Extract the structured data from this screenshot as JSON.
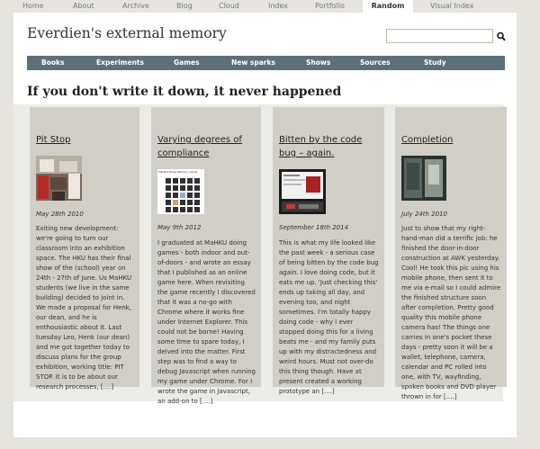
{
  "top_nav": {
    "items": [
      {
        "label": "Home"
      },
      {
        "label": "About"
      },
      {
        "label": "Archive"
      },
      {
        "label": "Blog"
      },
      {
        "label": "Cloud"
      },
      {
        "label": "Index"
      },
      {
        "label": "Portfolio"
      },
      {
        "label": "Random"
      },
      {
        "label": "Visual Index"
      }
    ],
    "active": "Random"
  },
  "header": {
    "site_title": "Everdien's external memory",
    "search": {
      "value": "",
      "placeholder": ""
    },
    "search_icon": "magnifier-icon"
  },
  "category_nav": {
    "items": [
      {
        "label": "Books"
      },
      {
        "label": "Experiments"
      },
      {
        "label": "Games"
      },
      {
        "label": "New sparks"
      },
      {
        "label": "Shows"
      },
      {
        "label": "Sources"
      },
      {
        "label": "Study"
      }
    ]
  },
  "main": {
    "headline": "If you don't write it down, it never happened",
    "cards": [
      {
        "title": "Pit Stop",
        "date": "May 28th 2010",
        "body": "Exiting new development: we're going to turn our classroom into an exhibition space. The HKU has their final show of the (school) year on 24th - 27th of June. Us MaHKU students (we live in the same building) decided to joint in. We made a proposal for Henk, our dean, and he is enthousiastic about it. Last tuesday Leo, Henk (our dean)  and me  got together today to discuss  plans for the group exhibition, working title:  PIT STOP. It is to be about our research processes,",
        "more": "[....]",
        "thumb_caption": ""
      },
      {
        "title": "Varying degrees of compliance",
        "date": "May 9th 2012",
        "body": "I graduated at MaHKU doing games - both indoor and out-of-doors - and wrote an essay that I published as an online game here. When revisiting the game recently I discovered that it was a no-go with Chrome where it works fine under Internet Explorer. This could not be borne! Having some time to spare today, I delved into the matter. First step was to find a way to debug Javascript when running my game under Chrome. For I wrote the game in Javascript, an add-on to",
        "more": "[....]",
        "thumb_caption": "MaHKU Essay Memory Game"
      },
      {
        "title": "Bitten by the code bug – again.",
        "date": "September 18th 2014",
        "body": "This is what my life looked like the past week - a serious case of being bitten by the code bug again. I love doing code, but it eats me up. 'Just checking this' ends up taking all day, and evening too, and night sometimes. I'm totally happy  doing code - why I ever stopped doing this for a living beats me - and my family puts up with my distractedness and weird hours. Must not over-do this thing though. Have at present created a working prototype an",
        "more": "[....]",
        "thumb_caption": ""
      },
      {
        "title": "Completion",
        "date": "July 24th 2010",
        "body": "Just to show that my right-hand-man did a terrific job: he finished the door-in-door construction at AWK yesterday. Cool! He took this pic using his mobile phone, then sent it to me via e-mail  so I could admire the finished structure soon after completion. Pretty good quality this mobile phone camera has! The things one carries in one's pocket these days -  pretty soon  it will be a wallet, telephone, camera, calendar and PC rolled into one, with TV, wayfinding, spoken books and DVD player thrown in for",
        "more": "[....]",
        "thumb_caption": ""
      }
    ]
  }
}
